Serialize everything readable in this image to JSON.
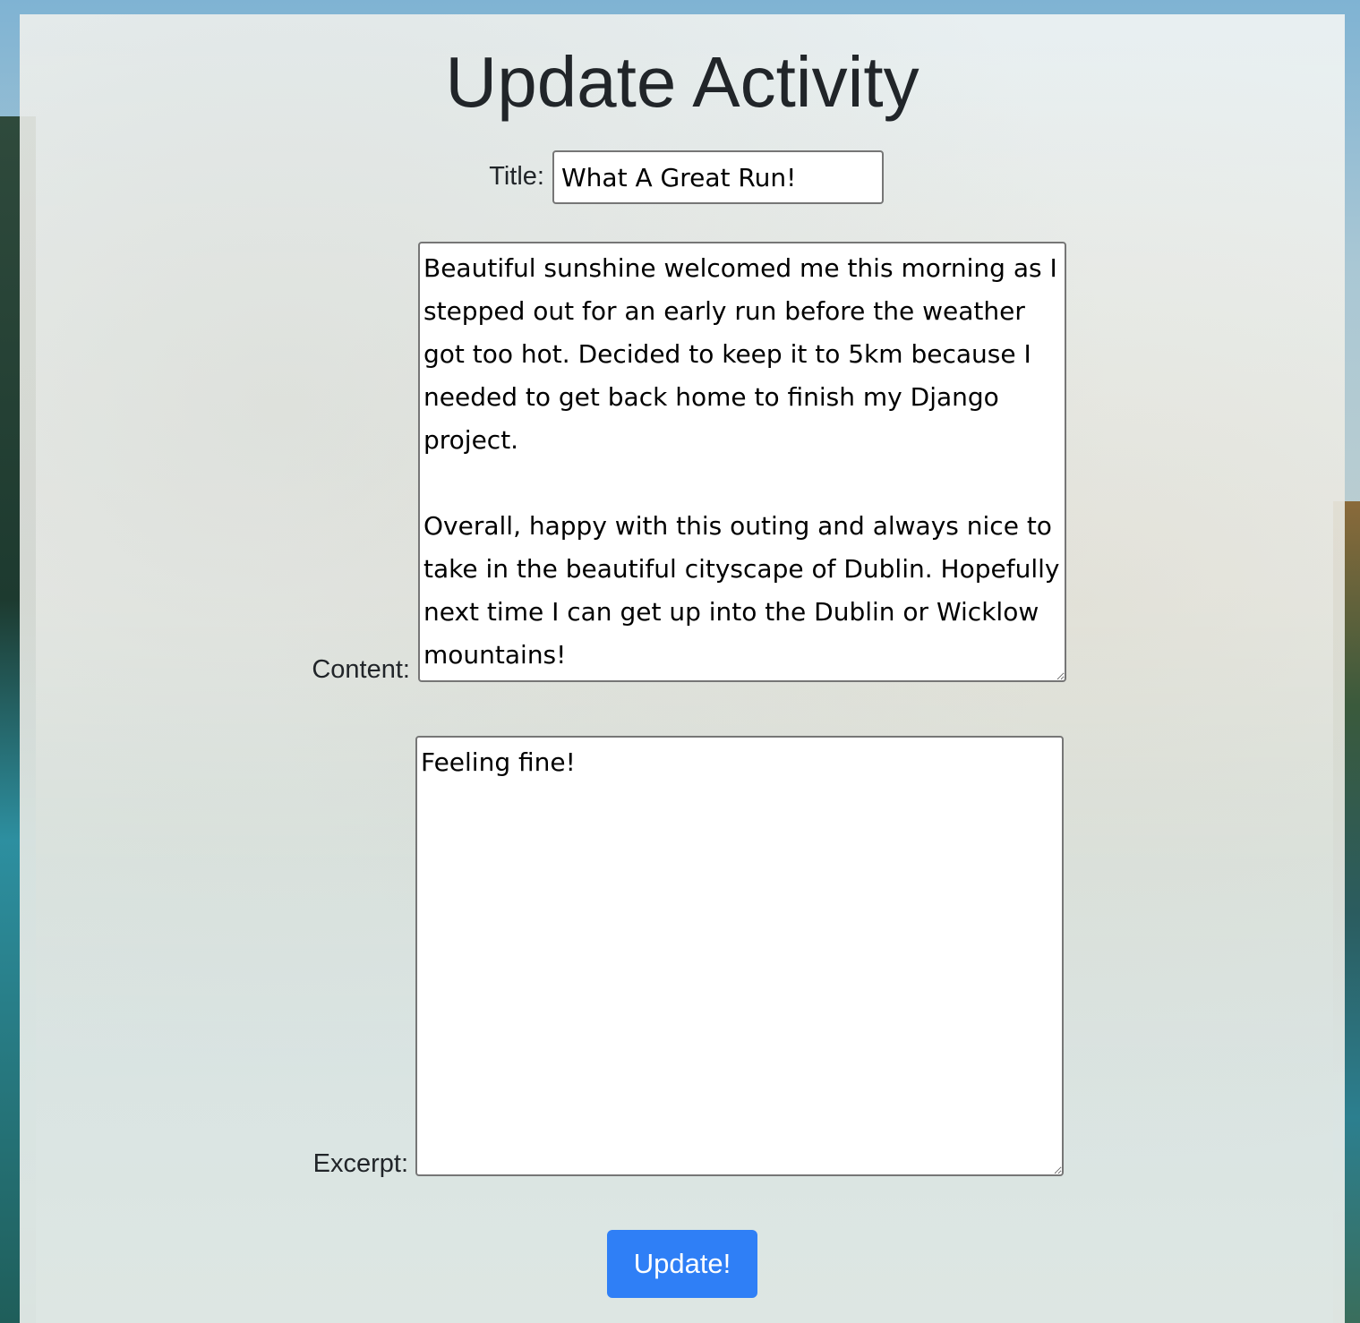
{
  "page": {
    "title": "Update Activity"
  },
  "form": {
    "title_label": "Title:",
    "title_value": "What A Great Run!",
    "content_label": "Content:",
    "content_value": "Beautiful sunshine welcomed me this morning as I stepped out for an early run before the weather got too hot. Decided to keep it to 5km because I needed to get back home to finish my Django project.\n\nOverall, happy with this outing and always nice to take in the beautiful cityscape of Dublin. Hopefully next time I can get up into the Dublin or Wicklow mountains!",
    "excerpt_label": "Excerpt:",
    "excerpt_value": "Feeling fine!",
    "submit_label": "Update!"
  },
  "colors": {
    "button": "#2f7ff6",
    "heading": "#212529"
  }
}
